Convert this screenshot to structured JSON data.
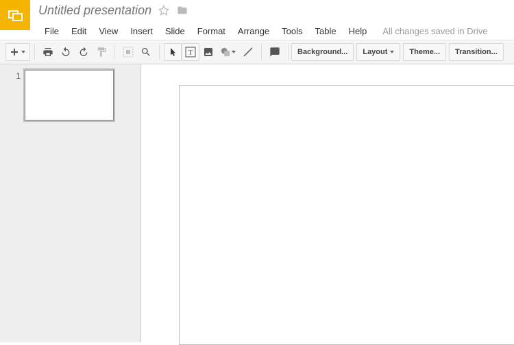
{
  "header": {
    "title": "Untitled presentation",
    "save_status": "All changes saved in Drive"
  },
  "menus": {
    "file": "File",
    "edit": "Edit",
    "view": "View",
    "insert": "Insert",
    "slide": "Slide",
    "format": "Format",
    "arrange": "Arrange",
    "tools": "Tools",
    "table": "Table",
    "help": "Help"
  },
  "toolbar": {
    "background": "Background...",
    "layout": "Layout",
    "theme": "Theme...",
    "transition": "Transition..."
  },
  "thumbs": {
    "slide1_num": "1"
  }
}
